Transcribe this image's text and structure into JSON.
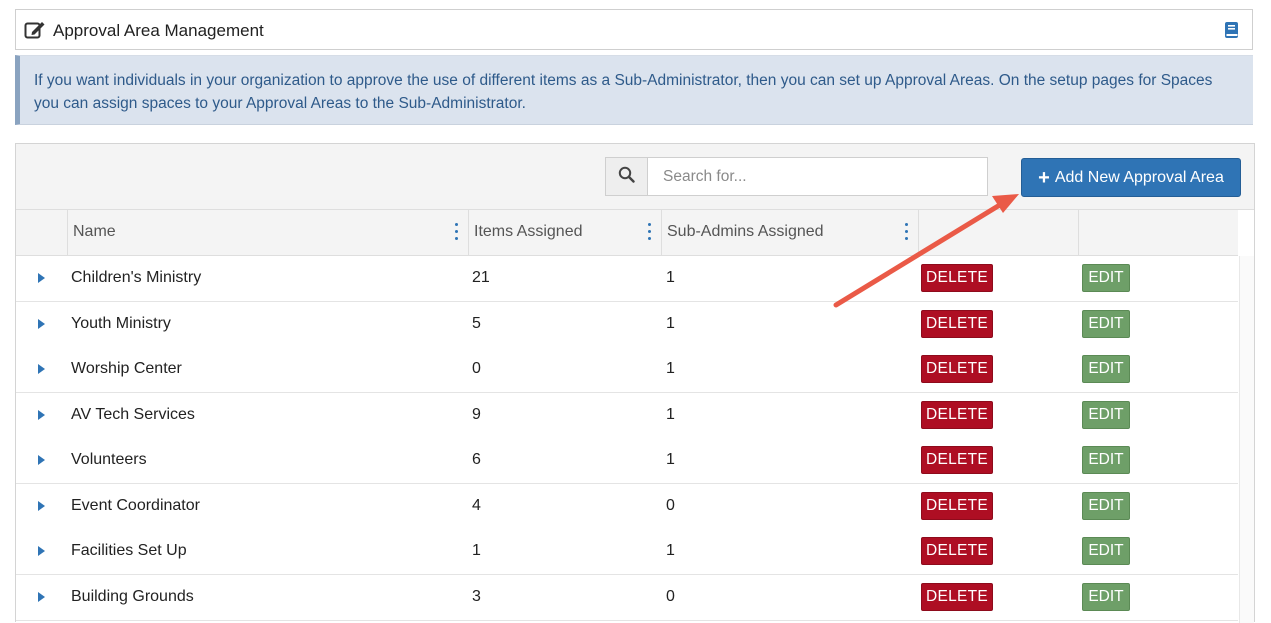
{
  "header": {
    "title": "Approval Area Management",
    "edit_icon": "edit-square-icon",
    "help_icon": "book-icon"
  },
  "info": {
    "text": "If you want individuals in your organization to approve the use of different items as a Sub-Administrator, then you can set up Approval Areas.  On the setup pages for Spaces you can assign spaces to your Approval Areas to the Sub-Administrator."
  },
  "toolbar": {
    "search_placeholder": "Search for...",
    "search_icon": "search-icon",
    "add_label": "Add New Approval Area",
    "add_icon": "plus-icon"
  },
  "table": {
    "columns": [
      "Name",
      "Items Assigned",
      "Sub-Admins Assigned"
    ],
    "rows": [
      {
        "name": "Children's Ministry",
        "items": "21",
        "subs": "1"
      },
      {
        "name": "Youth Ministry",
        "items": "5",
        "subs": "1"
      },
      {
        "name": "Worship Center",
        "items": "0",
        "subs": "1"
      },
      {
        "name": "AV Tech Services",
        "items": "9",
        "subs": "1"
      },
      {
        "name": "Volunteers",
        "items": "6",
        "subs": "1"
      },
      {
        "name": "Event Coordinator",
        "items": "4",
        "subs": "0"
      },
      {
        "name": "Facilities Set Up",
        "items": "1",
        "subs": "1"
      },
      {
        "name": "Building Grounds",
        "items": "3",
        "subs": "0"
      }
    ],
    "delete_label": "DELETE",
    "edit_label": "EDIT"
  },
  "colors": {
    "primary": "#2f74b5",
    "delete": "#ae0e23",
    "edit": "#6e9f68",
    "info_bg": "#dbe3ee",
    "info_text": "#2e5a8a",
    "annotation_arrow": "#ea5a47"
  }
}
